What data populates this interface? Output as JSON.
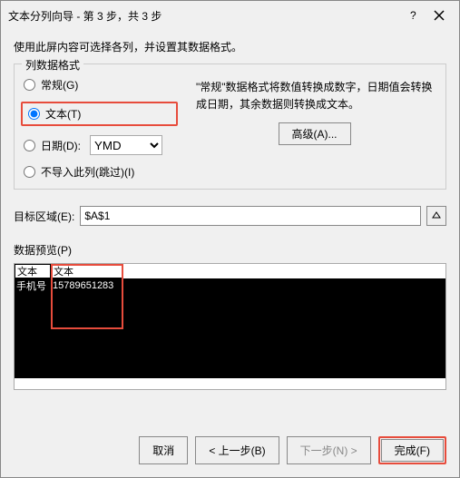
{
  "title": "文本分列向导 - 第 3 步，共 3 步",
  "instruction": "使用此屏内容可选择各列，并设置其数据格式。",
  "group_title": "列数据格式",
  "radios": {
    "general": "常规(G)",
    "text": "文本(T)",
    "date": "日期(D):",
    "skip": "不导入此列(跳过)(I)"
  },
  "date_value": "YMD",
  "description": "\"常规\"数据格式将数值转换成数字，日期值会转换成日期，其余数据则转换成文本。",
  "advanced_btn": "高级(A)...",
  "dest_label": "目标区域(E):",
  "dest_value": "$A$1",
  "preview_label": "数据预览(P)",
  "preview": {
    "headers": [
      "文本",
      "文本"
    ],
    "row1": [
      "手机号",
      "15789651283"
    ]
  },
  "footer": {
    "cancel": "取消",
    "back": "< 上一步(B)",
    "next": "下一步(N) >",
    "finish": "完成(F)"
  }
}
